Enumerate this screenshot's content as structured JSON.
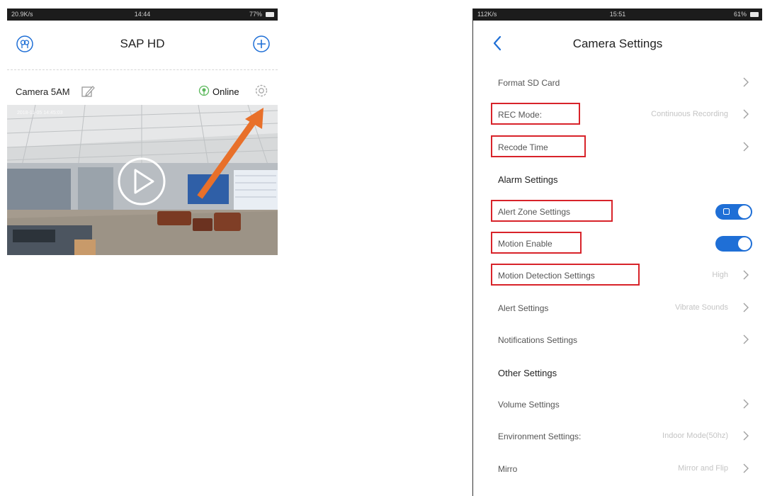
{
  "colors": {
    "accent": "#1f6fd6",
    "highlight": "#d8232a",
    "arrow": "#e8702a",
    "online": "#5cb85c"
  },
  "left": {
    "status": {
      "left": "20.9K/s",
      "time": "14:44",
      "right": "77%"
    },
    "title": "SAP HD",
    "camera": {
      "name": "Camera 5AM",
      "status": "Online",
      "timestamp": "2018-11-05 14:45:03"
    },
    "icons": {
      "profile": "profile-icon",
      "add": "add-circle-icon",
      "edit": "edit-icon",
      "online": "online-icon",
      "settings": "gear-icon",
      "play": "play-icon"
    }
  },
  "right": {
    "status": {
      "left": "112K/s",
      "time": "15:51",
      "right": "61%"
    },
    "title": "Camera Settings",
    "rows": [
      {
        "label": "Format SD Card",
        "value": "",
        "control": "chevron",
        "highlight": false
      },
      {
        "label": "REC Mode:",
        "value": "Continuous Recording",
        "control": "chevron",
        "highlight": true
      },
      {
        "label": "Recode Time",
        "value": "",
        "control": "chevron",
        "highlight": true
      },
      {
        "label": "Alarm Settings",
        "value": "",
        "control": "section",
        "highlight": false
      },
      {
        "label": "Alert Zone Settings",
        "value": "",
        "control": "toggle",
        "highlight": true,
        "on": true
      },
      {
        "label": "Motion Enable",
        "value": "",
        "control": "toggle",
        "highlight": true,
        "on": true
      },
      {
        "label": "Motion Detection Settings",
        "value": "High",
        "control": "chevron",
        "highlight": true
      },
      {
        "label": "Alert Settings",
        "value": "Vibrate Sounds",
        "control": "chevron",
        "highlight": false
      },
      {
        "label": "Notifications Settings",
        "value": "",
        "control": "chevron",
        "highlight": false
      },
      {
        "label": "Other Settings",
        "value": "",
        "control": "section",
        "highlight": false
      },
      {
        "label": "Volume Settings",
        "value": "",
        "control": "chevron",
        "highlight": false
      },
      {
        "label": "Environment Settings:",
        "value": "Indoor Mode(50hz)",
        "control": "chevron",
        "highlight": false
      },
      {
        "label": "Mirro",
        "value": "Mirror and Flip",
        "control": "chevron",
        "highlight": false
      }
    ]
  }
}
